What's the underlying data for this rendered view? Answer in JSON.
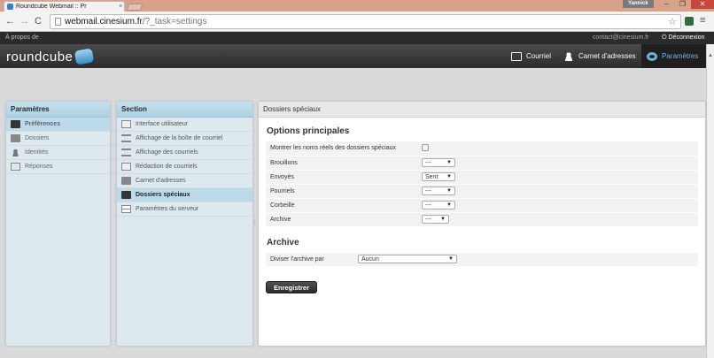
{
  "browser": {
    "tab_title": "Roundcube Webmail :: Pr",
    "tab_close": "×",
    "profile_name": "Yannick",
    "url_host": "webmail.cinesium.fr",
    "url_path": "/?_task=settings",
    "nav_back": "←",
    "nav_forward": "→",
    "nav_reload": "C",
    "star": "☆",
    "menu": "≡",
    "win_min": "–",
    "win_max": "❐",
    "win_close": "✕"
  },
  "topline": {
    "about": "À propos de",
    "user_email": "contact@cinesium.fr",
    "logout": "Déconnexion",
    "logout_icon": "⏻"
  },
  "header": {
    "logo_text": "roundcube",
    "nav": {
      "mail": "Courriel",
      "contacts": "Carnet d'adresses",
      "settings": "Paramètres"
    },
    "accent_color": "#67b6e8"
  },
  "prefs_panel": {
    "title": "Paramètres",
    "items": [
      {
        "label": "Préférences",
        "icon": "computer-icon",
        "active": true
      },
      {
        "label": "Dossiers",
        "icon": "folder-icon",
        "active": false
      },
      {
        "label": "Identités",
        "icon": "identity-icon",
        "active": false
      },
      {
        "label": "Réponses",
        "icon": "responses-icon",
        "active": false
      }
    ]
  },
  "section_panel": {
    "title": "Section",
    "items": [
      {
        "label": "Interface utilisateur",
        "icon": "computer-icon",
        "active": false
      },
      {
        "label": "Affichage de la boîte de courriel",
        "icon": "list-icon",
        "active": false
      },
      {
        "label": "Affichage des courriels",
        "icon": "list-icon",
        "active": false
      },
      {
        "label": "Rédaction de courriels",
        "icon": "compose-icon",
        "active": false
      },
      {
        "label": "Carnet d'adresses",
        "icon": "address-book-icon",
        "active": false
      },
      {
        "label": "Dossiers spéciaux",
        "icon": "folder-icon",
        "active": true
      },
      {
        "label": "Paramètres du serveur",
        "icon": "server-icon",
        "active": false
      }
    ]
  },
  "content": {
    "title": "Dossiers spéciaux",
    "main_fieldset": {
      "legend": "Options principales",
      "rows": {
        "show_real_names": "Montrer les noms réels des dossiers spéciaux",
        "drafts": {
          "label": "Brouillons",
          "value": "---"
        },
        "sent": {
          "label": "Envoyés",
          "value": "Sent"
        },
        "junk": {
          "label": "Pourriels",
          "value": "---"
        },
        "trash": {
          "label": "Corbeille",
          "value": "---"
        },
        "archive": {
          "label": "Archive",
          "value": "---"
        }
      }
    },
    "archive_fieldset": {
      "legend": "Archive",
      "split_label": "Diviser l'archive par",
      "split_value": "Aucun"
    },
    "save_button": "Enregistrer"
  }
}
